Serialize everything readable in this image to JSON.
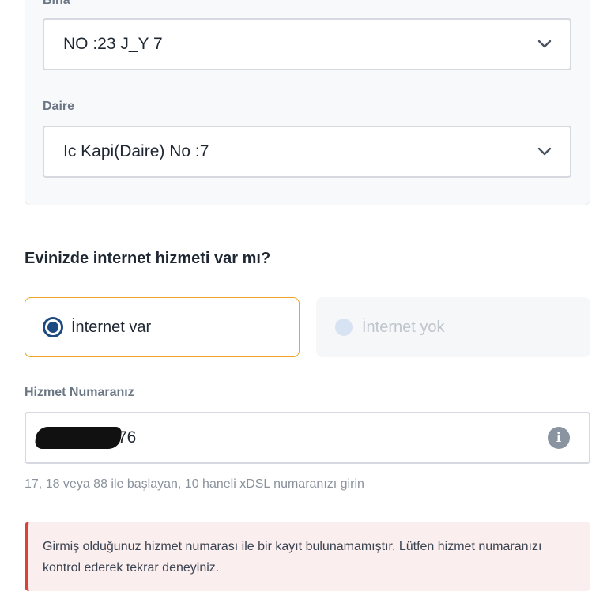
{
  "address": {
    "building_label": "Bina",
    "building_value": "NO :23 J_Y 7",
    "apartment_label": "Daire",
    "apartment_value": "Ic Kapi(Daire) No :7"
  },
  "internet": {
    "question": "Evinizde internet hizmeti var mı?",
    "option_yes": "İnternet var",
    "option_no": "İnternet yok",
    "selected": "yes"
  },
  "service_number": {
    "label": "Hizmet Numaranız",
    "visible_suffix": "76",
    "hint": "17, 18 veya 88 ile başlayan, 10 haneli xDSL numaranızı girin",
    "info_icon": "info-icon"
  },
  "error": {
    "message": "Girmiş olduğunuz hizmet numarası ile bir kayıt bulunamamıştır. Lütfen hizmet numaranızı kontrol ederek tekrar deneyiniz."
  },
  "colors": {
    "accent_orange": "#f0a425",
    "radio_blue": "#1e4a82",
    "error_red": "#d9413b",
    "error_bg": "#fbeeee"
  }
}
